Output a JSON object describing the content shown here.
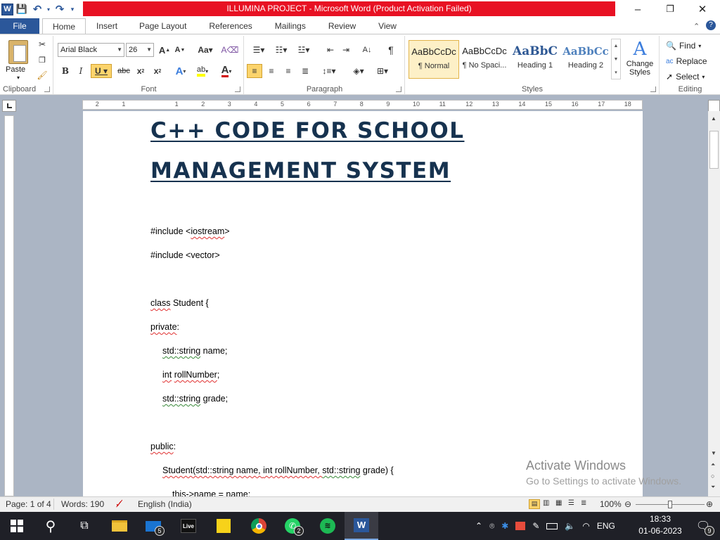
{
  "window": {
    "title": "ILLUMINA PROJECT -  Microsoft Word (Product Activation Failed)",
    "minimize": "–",
    "restore": "❐",
    "close": "✕"
  },
  "qat": {
    "word_logo": "W",
    "save": "💾",
    "undo": "↶",
    "redo": "↷"
  },
  "tabs": [
    {
      "label": "File"
    },
    {
      "label": "Home"
    },
    {
      "label": "Insert"
    },
    {
      "label": "Page Layout"
    },
    {
      "label": "References"
    },
    {
      "label": "Mailings"
    },
    {
      "label": "Review"
    },
    {
      "label": "View"
    }
  ],
  "ribbon": {
    "clipboard": {
      "label": "Clipboard",
      "paste": "Paste"
    },
    "font": {
      "label": "Font",
      "family": "Arial Black",
      "size": "26"
    },
    "paragraph": {
      "label": "Paragraph"
    },
    "styles": {
      "label": "Styles",
      "items": [
        {
          "preview": "AaBbCcDc",
          "name": "¶ Normal"
        },
        {
          "preview": "AaBbCcDc",
          "name": "¶ No Spaci..."
        },
        {
          "preview": "AaBbC",
          "name": "Heading 1"
        },
        {
          "preview": "AaBbCc",
          "name": "Heading 2"
        }
      ],
      "change": "Change Styles"
    },
    "editing": {
      "label": "Editing",
      "find": "Find",
      "replace": "Replace",
      "select": "Select"
    }
  },
  "ruler": {
    "ticks": [
      "2",
      "1",
      "1",
      "2",
      "3",
      "4",
      "5",
      "6",
      "7",
      "8",
      "9",
      "10",
      "11",
      "12",
      "13",
      "14",
      "15",
      "16",
      "17",
      "18"
    ]
  },
  "document": {
    "heading_line1": "C++ CODE FOR SCHOOL",
    "heading_line2": "MANAGEMENT SYSTEM",
    "lines": {
      "l1_a": "#include <",
      "l1_b": "iostream",
      "l1_c": ">",
      "l2": "#include <vector>",
      "l3_a": "class",
      "l3_b": " Student {",
      "l4": "private",
      "l4_c": ":",
      "l5_a": "std::string",
      "l5_b": " name;",
      "l6_a": "int",
      "l6_b": "rollNumber",
      "l6_c": ";",
      "l7_a": "std::string",
      "l7_b": " grade;",
      "l8": "public",
      "l8_c": ":",
      "l9_a": "Student(std::string name, ",
      "l9_b": "int",
      "l9_c": " rollNumber, ",
      "l9_d": "std::string",
      "l9_e": " grade) {",
      "l10": "this->name = name;"
    }
  },
  "watermark": {
    "line1": "Activate Windows",
    "line2": "Go to Settings to activate Windows."
  },
  "statusbar": {
    "page": "Page: 1 of 4",
    "words": "Words: 190",
    "language": "English (India)",
    "zoom": "100%",
    "zoom_level": 0.5
  },
  "taskbar": {
    "mail_badge": "5",
    "whatsapp_badge": "2",
    "live_label": "Live",
    "word_label": "W",
    "tray_lang": "ENG",
    "time": "18:33",
    "date": "01-06-2023",
    "notif_badge": "9"
  }
}
